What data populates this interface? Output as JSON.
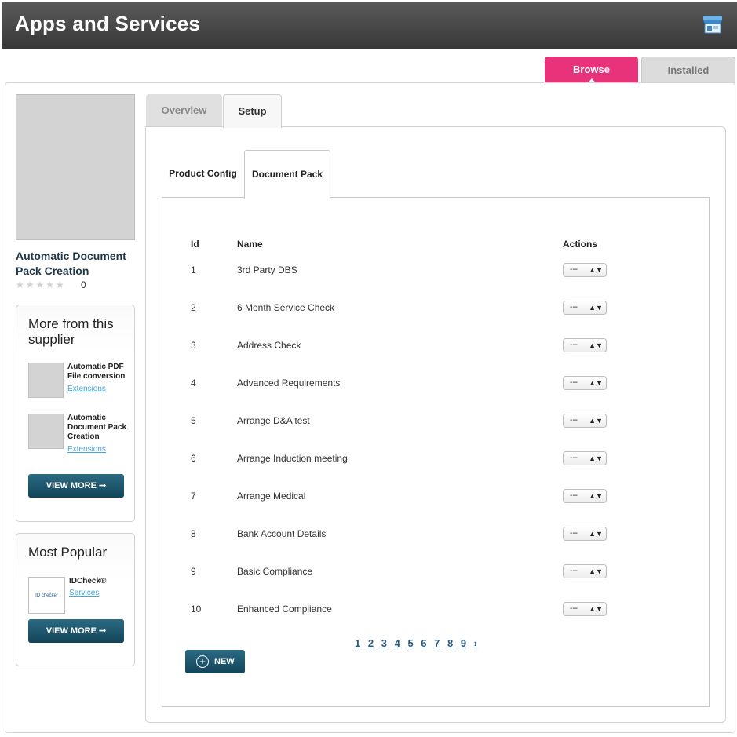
{
  "header": {
    "title": "Apps and Services",
    "store_icon": "store-icon"
  },
  "top_tabs": {
    "browse": "Browse",
    "installed": "Installed"
  },
  "product": {
    "title": "Automatic Document Pack Creation",
    "stars": "★★★★★",
    "rating_count": "0"
  },
  "supplier_box": {
    "title": "More from this supplier",
    "items": [
      {
        "name": "Automatic PDF File conversion",
        "link": "Extensions"
      },
      {
        "name": "Automatic Document Pack Creation",
        "link": "Extensions"
      }
    ],
    "view_more": "VIEW MORE ➞"
  },
  "popular_box": {
    "title": "Most Popular",
    "items": [
      {
        "name": "IDCheck®",
        "link": "Services",
        "logo_text": "ID checker"
      }
    ],
    "view_more": "VIEW MORE ➞"
  },
  "main_tabs": {
    "overview": "Overview",
    "setup": "Setup"
  },
  "sub_tabs": {
    "product_config": "Product Config",
    "document_pack": "Document Pack"
  },
  "table": {
    "headers": {
      "id": "Id",
      "name": "Name",
      "actions": "Actions"
    },
    "select_value": "---",
    "rows": [
      {
        "id": "1",
        "name": "3rd Party DBS"
      },
      {
        "id": "2",
        "name": "6 Month Service Check"
      },
      {
        "id": "3",
        "name": "Address Check"
      },
      {
        "id": "4",
        "name": "Advanced Requirements"
      },
      {
        "id": "5",
        "name": "Arrange D&A test"
      },
      {
        "id": "6",
        "name": "Arrange Induction meeting"
      },
      {
        "id": "7",
        "name": "Arrange Medical"
      },
      {
        "id": "8",
        "name": "Bank Account Details"
      },
      {
        "id": "9",
        "name": "Basic Compliance"
      },
      {
        "id": "10",
        "name": "Enhanced Compliance"
      }
    ]
  },
  "pagination": {
    "pages": [
      "1",
      "2",
      "3",
      "4",
      "5",
      "6",
      "7",
      "8",
      "9"
    ],
    "next": "›"
  },
  "new_button": {
    "label": "NEW",
    "icon": "plus-circle-icon"
  }
}
